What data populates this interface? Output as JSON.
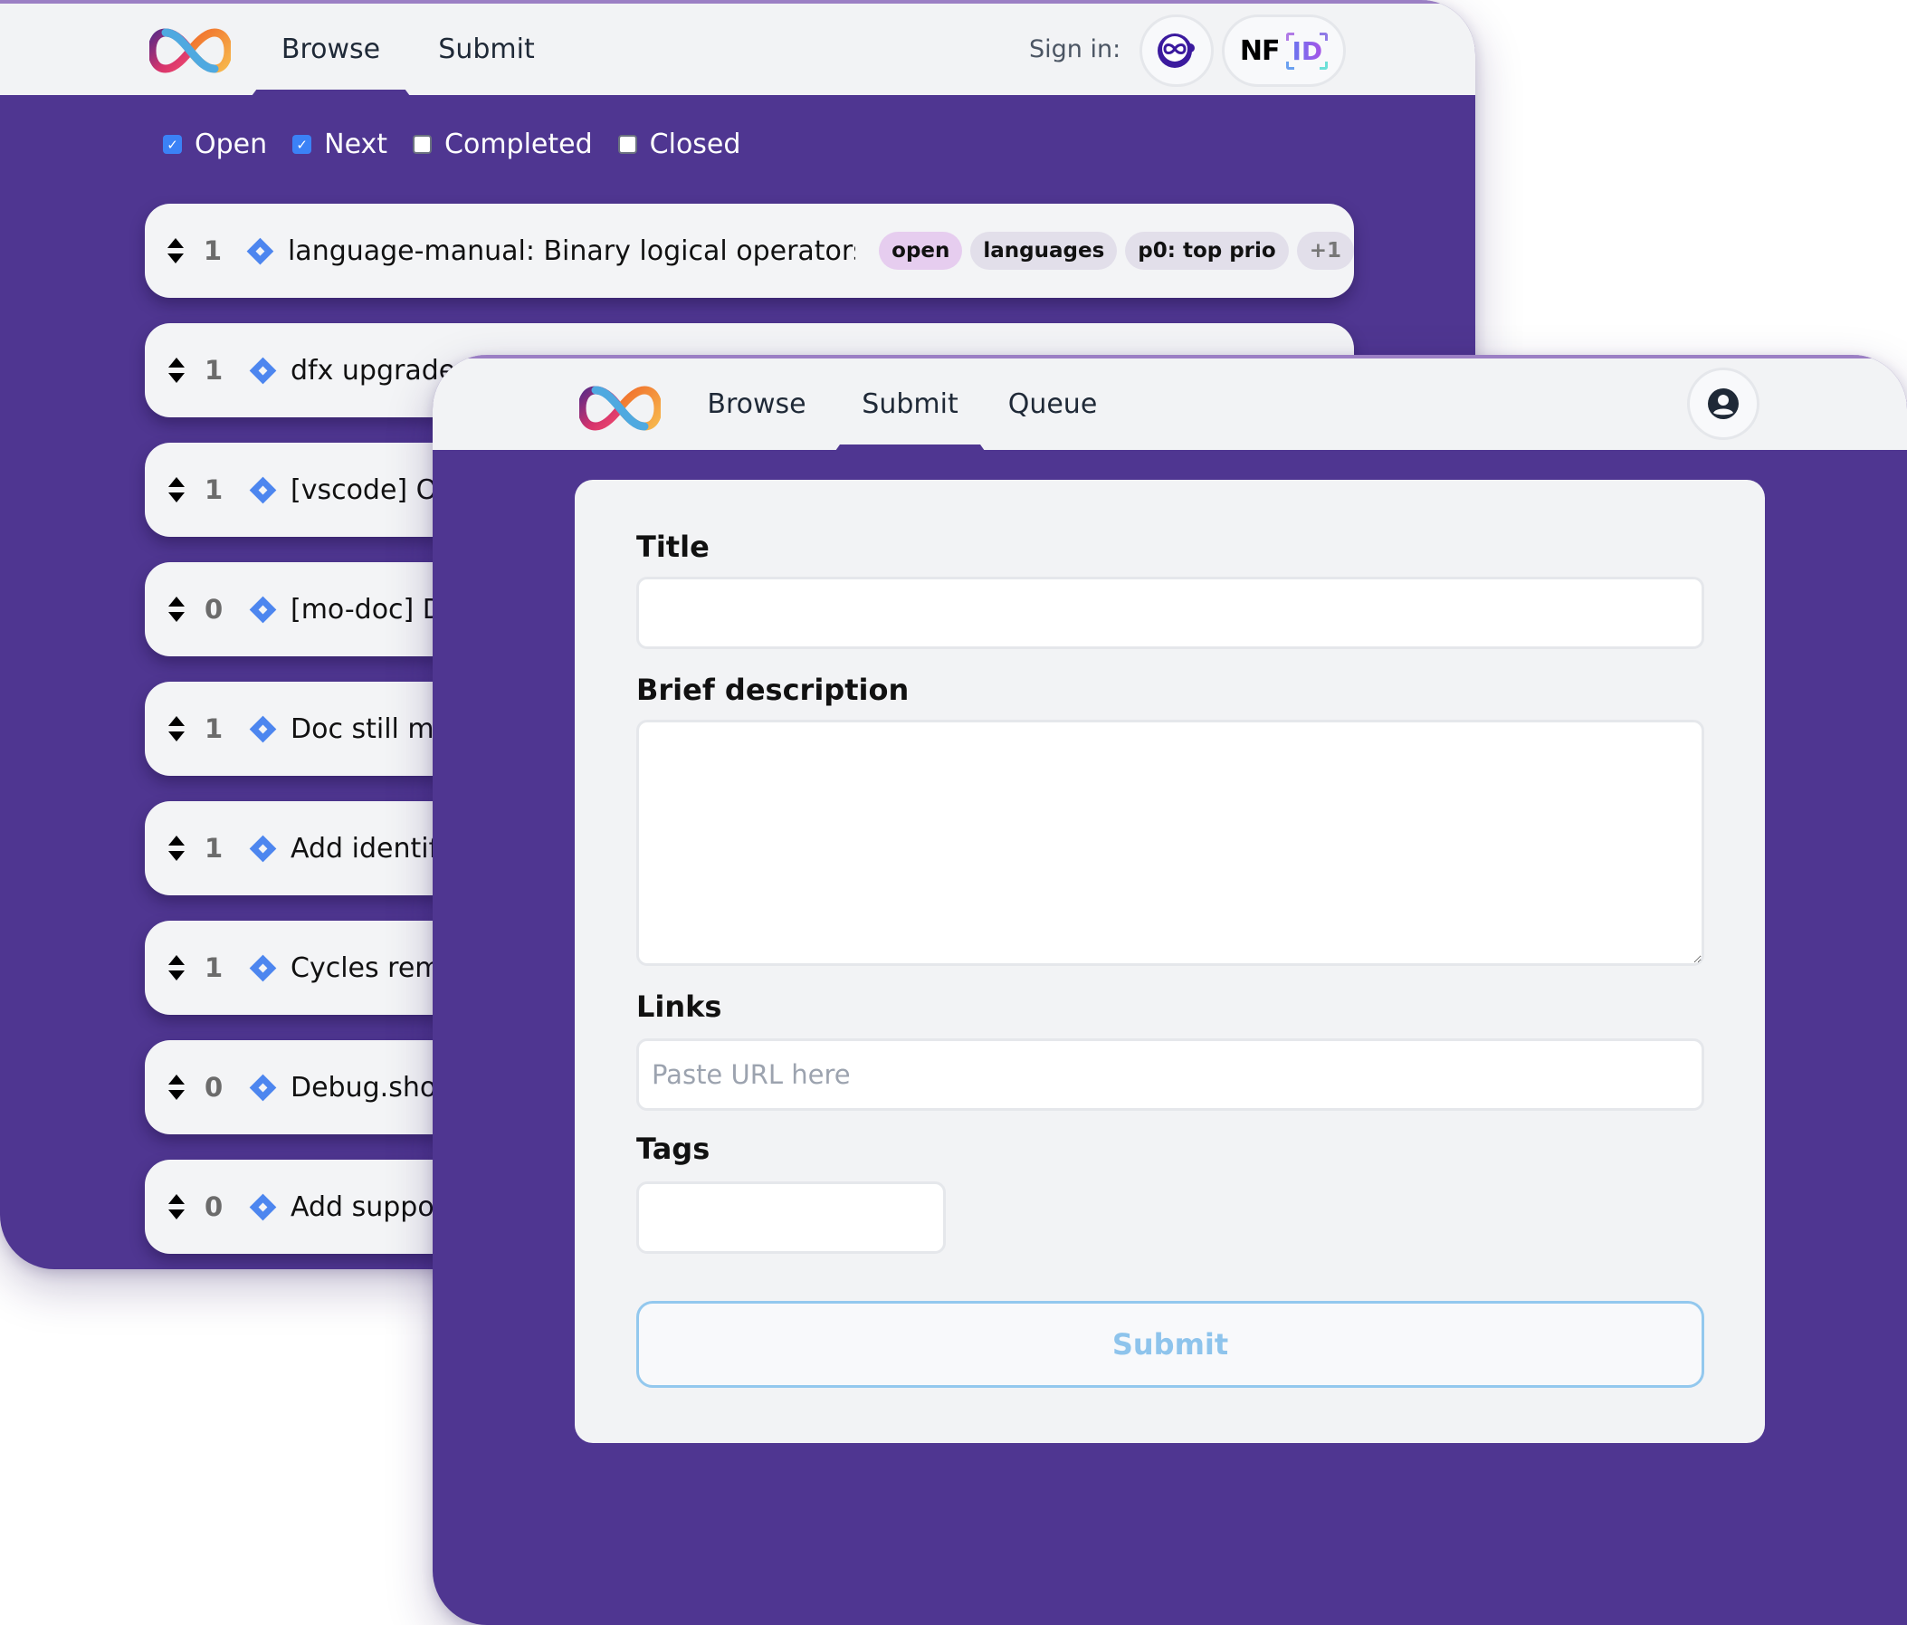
{
  "back_window": {
    "nav": {
      "tabs": [
        {
          "label": "Browse",
          "active": true
        },
        {
          "label": "Submit",
          "active": false
        }
      ]
    },
    "signin": {
      "label": "Sign in:",
      "providers": [
        {
          "name": "Internet Identity",
          "icon": "internet-identity-icon"
        },
        {
          "name": "NFID",
          "text": "NF",
          "badge": "ID"
        }
      ]
    },
    "filters": [
      {
        "label": "Open",
        "checked": true
      },
      {
        "label": "Next",
        "checked": true
      },
      {
        "label": "Completed",
        "checked": false
      },
      {
        "label": "Closed",
        "checked": false
      }
    ],
    "issues": [
      {
        "votes": "1",
        "title": "language-manual: Binary logical operators miss",
        "tags": [
          "open",
          "languages",
          "p0: top prio"
        ],
        "more_tags": "+1"
      },
      {
        "votes": "1",
        "title": "dfx upgrade",
        "tags": [],
        "more_tags": ""
      },
      {
        "votes": "1",
        "title": "[vscode] Op",
        "tags": [],
        "more_tags": ""
      },
      {
        "votes": "0",
        "title": "[mo-doc] D",
        "tags": [],
        "more_tags": ""
      },
      {
        "votes": "1",
        "title": "Doc still me",
        "tags": [],
        "more_tags": ""
      },
      {
        "votes": "1",
        "title": "Add identifi",
        "tags": [],
        "more_tags": ""
      },
      {
        "votes": "1",
        "title": "Cycles rema",
        "tags": [],
        "more_tags": ""
      },
      {
        "votes": "0",
        "title": "Debug.shov",
        "tags": [],
        "more_tags": ""
      },
      {
        "votes": "0",
        "title": "Add suppor",
        "tags": [],
        "more_tags": ""
      }
    ]
  },
  "front_window": {
    "nav": {
      "tabs": [
        {
          "label": "Browse",
          "active": false
        },
        {
          "label": "Submit",
          "active": true
        },
        {
          "label": "Queue",
          "active": false
        }
      ]
    },
    "account_icon": "user-circle-icon",
    "form": {
      "title_label": "Title",
      "title_value": "",
      "description_label": "Brief description",
      "description_value": "",
      "links_label": "Links",
      "links_placeholder": "Paste URL here",
      "links_value": "",
      "tags_label": "Tags",
      "tags_value": "",
      "submit_label": "Submit"
    }
  },
  "colors": {
    "brand_purple": "#4f3691",
    "header_bg": "#f2f3f5",
    "checkbox_blue": "#3b82f6",
    "issue_icon_blue": "#4d86ef",
    "tag_open": "#e6cdef",
    "tag_default": "#e2dfea",
    "submit_border": "#93c8ee"
  }
}
